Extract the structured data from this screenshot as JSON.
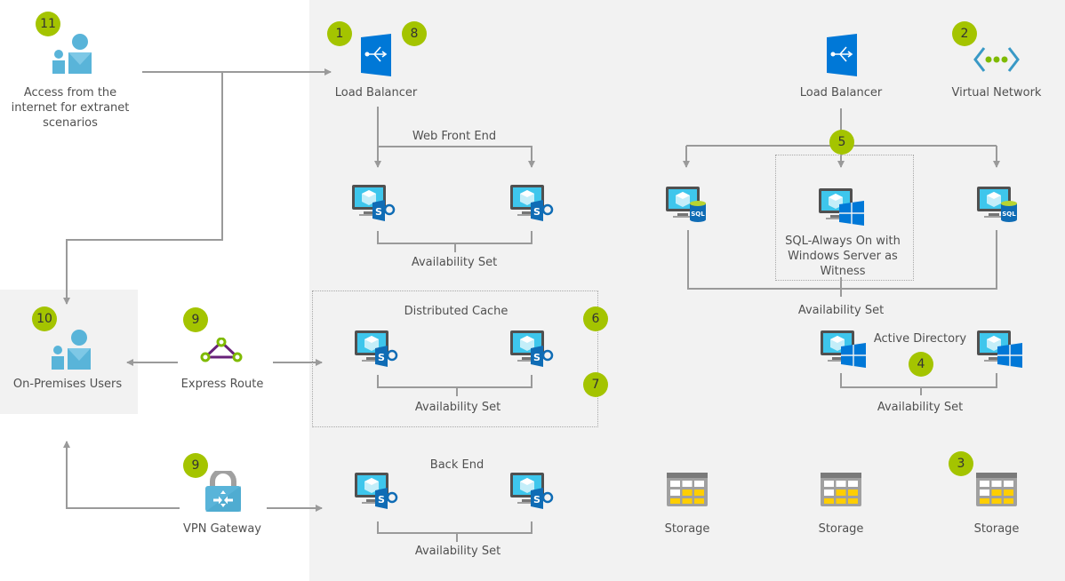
{
  "colors": {
    "badge": "#a4c400",
    "azure_blue": "#0078d7",
    "users_blue": "#59b4d9",
    "connector_gray": "#9a9a9a",
    "expressroute_purple": "#68217a",
    "storage_yellow": "#ffce00"
  },
  "external": {
    "internet_users": {
      "badge": "11",
      "label": "Access from the internet for extranet scenarios",
      "icon": "users-icon"
    },
    "onprem_users": {
      "badge": "10",
      "label": "On-Premises Users",
      "icon": "users-icon"
    },
    "express_route": {
      "badge": "9",
      "label": "Express Route",
      "icon": "express-route-icon"
    },
    "vpn_gateway": {
      "badge": "9",
      "label": "VPN Gateway",
      "icon": "vpn-gateway-icon"
    }
  },
  "azure": {
    "lb_web": {
      "badges": [
        "1",
        "8"
      ],
      "label": "Load Balancer",
      "icon": "load-balancer-icon"
    },
    "lb_sql": {
      "label": "Load Balancer",
      "icon": "load-balancer-icon"
    },
    "vnet": {
      "badge": "2",
      "label": "Virtual Network",
      "icon": "virtual-network-icon"
    },
    "web_front_end": {
      "title": "Web Front End",
      "set_label": "Availability Set"
    },
    "distributed_cache": {
      "title": "Distributed Cache",
      "set_label": "Availability Set",
      "badges": [
        "6",
        "7"
      ]
    },
    "back_end": {
      "title": "Back End",
      "set_label": "Availability Set"
    },
    "sql": {
      "badge": "5",
      "witness_label": "SQL-Always On with Windows Server as Witness",
      "set_label": "Availability Set",
      "db_tag": "SQL"
    },
    "active_directory": {
      "title": "Active Directory",
      "badge": "4",
      "set_label": "Availability Set"
    },
    "storage": {
      "badge": "3",
      "items": [
        "Storage",
        "Storage",
        "Storage"
      ]
    },
    "sharepoint_tag": "S"
  }
}
